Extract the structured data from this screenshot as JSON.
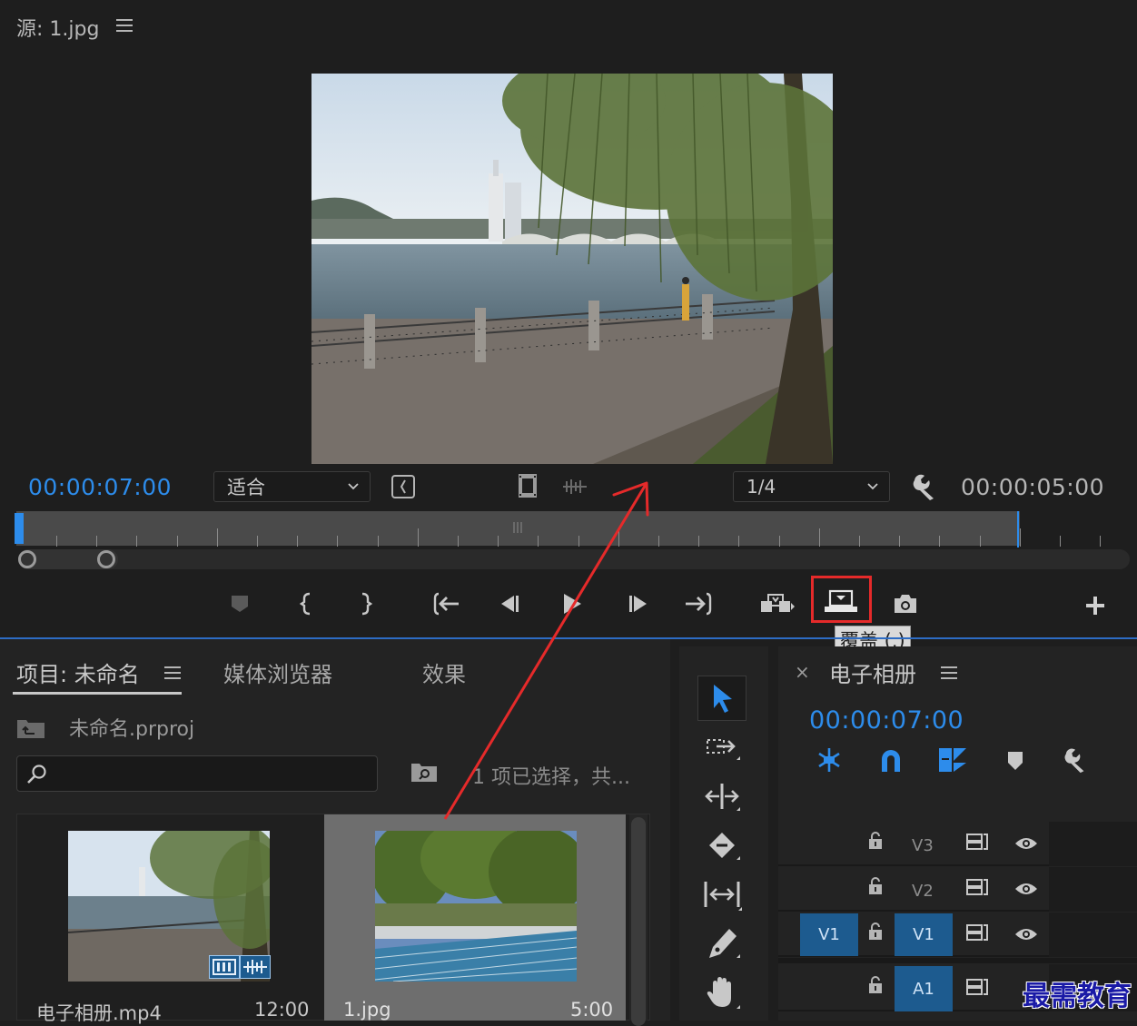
{
  "source_monitor": {
    "title": "源: 1.jpg",
    "current_time": "00:00:07:00",
    "fit_label": "适合",
    "resolution": "1/4",
    "duration": "00:00:05:00",
    "overwrite_tooltip": "覆盖 (.)"
  },
  "project_panel": {
    "tabs": [
      "项目: 未命名",
      "媒体浏览器",
      "效果"
    ],
    "project_file": "未命名.prproj",
    "search_placeholder": "",
    "selection_status": "1 项已选择，共...",
    "items": [
      {
        "name": "电子相册.mp4",
        "duration": "12:00"
      },
      {
        "name": "1.jpg",
        "duration": "5:00"
      }
    ]
  },
  "sequence_panel": {
    "title": "电子相册",
    "current_time": "00:00:07:00",
    "tracks": [
      {
        "label": "V3",
        "target": ""
      },
      {
        "label": "V2",
        "target": ""
      },
      {
        "label": "V1",
        "target": "V1"
      },
      {
        "label": "A1",
        "target": ""
      }
    ]
  },
  "watermark": "最需教育",
  "colors": {
    "accent_blue": "#2d8ceb",
    "highlight_red": "#e52a2a",
    "track_target": "#1d5b8f"
  }
}
